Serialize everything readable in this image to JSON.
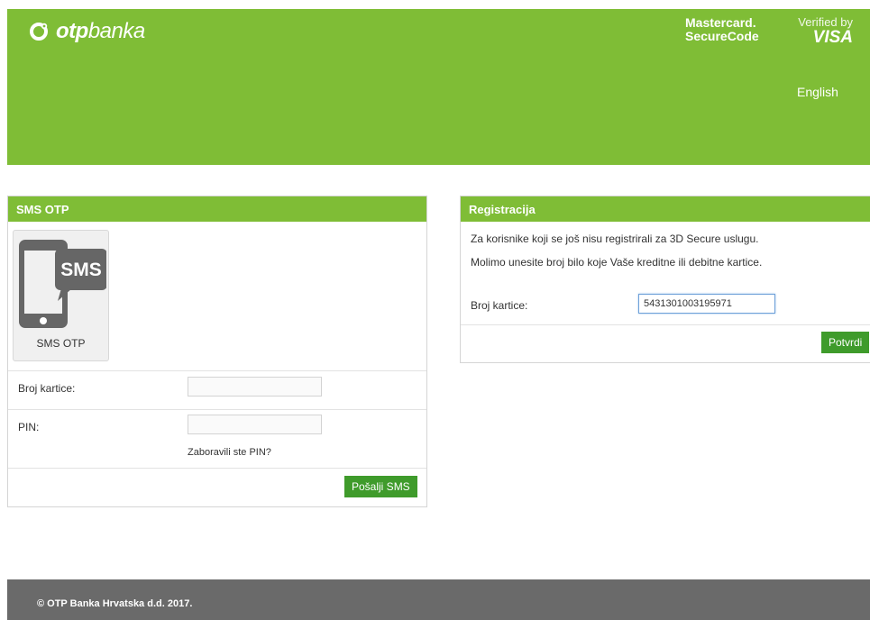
{
  "header": {
    "logo_bold": "otp",
    "logo_light": "banka",
    "mastercard_line1": "Mastercard.",
    "mastercard_line2": "SecureCode",
    "visa_line1": "Verified by",
    "visa_line2": "VISA",
    "language_link": "English",
    "bg_color": "#7fbd36"
  },
  "sms_panel": {
    "title": "SMS OTP",
    "tile_label": "SMS OTP",
    "tile_icon_text": "SMS",
    "card_label": "Broj kartice:",
    "card_value": "",
    "pin_label": "PIN:",
    "pin_value": "",
    "forgot_pin_link": "Zaboravili ste PIN?",
    "send_button": "Pošalji SMS"
  },
  "registration_panel": {
    "title": "Registracija",
    "line1": "Za korisnike koji se još nisu registrirali za 3D Secure uslugu.",
    "line2": "Molimo unesite broj bilo koje Vaše kreditne ili debitne kartice.",
    "card_label": "Broj kartice:",
    "card_value": "5431301003195971",
    "confirm_button": "Potvrdi"
  },
  "footer": {
    "copyright": "© OTP Banka Hrvatska d.d. 2017."
  },
  "colors": {
    "accent": "#7fbd36",
    "button": "#3f9b2b",
    "footer": "#6a6a6a"
  }
}
